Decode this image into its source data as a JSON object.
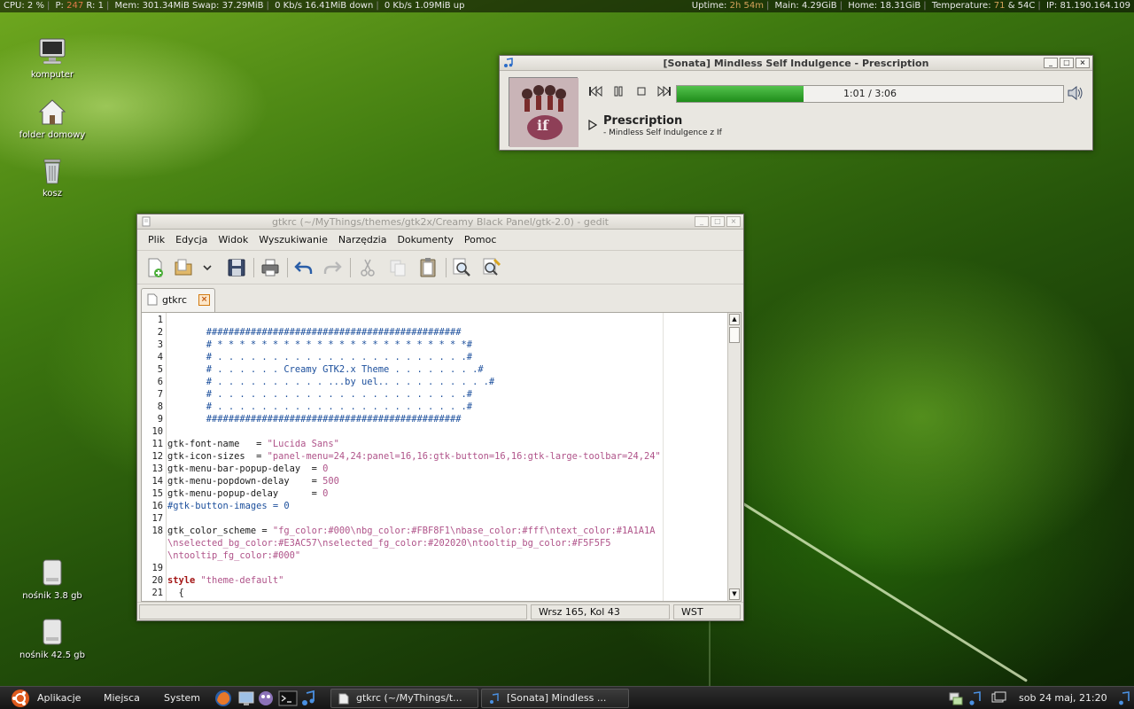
{
  "conky": {
    "cpu_label": "CPU:",
    "cpu_value": "2",
    "cpu_unit": "%",
    "proc_label": "P:",
    "proc_value": "247",
    "run_label": "R:",
    "run_value": "1",
    "mem_text": "Mem: 301.34MiB Swap: 37.29MiB",
    "down_text": "0  Kb/s 16.41MiB down",
    "up_text": "0  Kb/s 1.09MiB up",
    "uptime_label": "Uptime:",
    "uptime_value": "2h 54m",
    "main_text": "Main: 4.29GiB",
    "home_text": "Home: 18.31GiB",
    "temp_label": "Temperature:",
    "temp_value": "71",
    "temp_extra": "& 54C",
    "ip_text": "IP: 81.190.164.109"
  },
  "desktop": {
    "icons": [
      {
        "label": "komputer",
        "icon": "computer-icon"
      },
      {
        "label": "folder domowy",
        "icon": "home-folder-icon"
      },
      {
        "label": "kosz",
        "icon": "trash-icon"
      },
      {
        "label": "nośnik 3.8 gb",
        "icon": "drive-icon"
      },
      {
        "label": "nośnik 42.5 gb",
        "icon": "drive-icon"
      }
    ]
  },
  "sonata": {
    "title": "[Sonata] Mindless Self Indulgence - Prescription",
    "time": "1:01 / 3:06",
    "progress": 0.328,
    "song": "Prescription",
    "artist_line": "- Mindless Self Indulgence z If",
    "art_text": "if",
    "win_buttons": [
      "_",
      "□",
      "×"
    ]
  },
  "gedit": {
    "title": "gtkrc (~/MyThings/themes/gtk2x/Creamy Black Panel/gtk-2.0) - gedit",
    "menu": [
      "Plik",
      "Edycja",
      "Widok",
      "Wyszukiwanie",
      "Narzędzia",
      "Dokumenty",
      "Pomoc"
    ],
    "tab_label": "gtkrc",
    "tab_close": "×",
    "status_position": "Wrsz 165, Kol 43",
    "status_mode": "WST",
    "lines": [
      {
        "n": "1",
        "parts": [
          {
            "t": "",
            "c": ""
          }
        ]
      },
      {
        "n": "2",
        "parts": [
          {
            "t": "       ##############################################",
            "c": "cmt"
          }
        ]
      },
      {
        "n": "3",
        "parts": [
          {
            "t": "       # * * * * * * * * * * * * * * * * * * * * * * *#",
            "c": "cmt"
          }
        ]
      },
      {
        "n": "4",
        "parts": [
          {
            "t": "       # . . . . . . . . . . . . . . . . . . . . . . .#",
            "c": "cmt"
          }
        ]
      },
      {
        "n": "5",
        "parts": [
          {
            "t": "       # . . . . . . Creamy GTK2.x Theme . . . . . . . .#",
            "c": "cmt"
          }
        ]
      },
      {
        "n": "6",
        "parts": [
          {
            "t": "       # . . . . . . . . . . ...by uel.. . . . . . . . . .#",
            "c": "cmt"
          }
        ]
      },
      {
        "n": "7",
        "parts": [
          {
            "t": "       # . . . . . . . . . . . . . . . . . . . . . . .#",
            "c": "cmt"
          }
        ]
      },
      {
        "n": "8",
        "parts": [
          {
            "t": "       # . . . . . . . . . . . . . . . . . . . . . . .#",
            "c": "cmt"
          }
        ]
      },
      {
        "n": "9",
        "parts": [
          {
            "t": "       ##############################################",
            "c": "cmt"
          }
        ]
      },
      {
        "n": "10",
        "parts": [
          {
            "t": "",
            "c": ""
          }
        ]
      },
      {
        "n": "11",
        "parts": [
          {
            "t": "gtk-font-name   = ",
            "c": ""
          },
          {
            "t": "\"Lucida Sans\"",
            "c": "str"
          }
        ]
      },
      {
        "n": "12",
        "parts": [
          {
            "t": "gtk-icon-sizes  = ",
            "c": ""
          },
          {
            "t": "\"panel-menu=24,24:panel=16,16:gtk-button=16,16:gtk-large-toolbar=24,24\"",
            "c": "str"
          }
        ]
      },
      {
        "n": "13",
        "parts": [
          {
            "t": "gtk-menu-bar-popup-delay  = ",
            "c": ""
          },
          {
            "t": "0",
            "c": "num"
          }
        ]
      },
      {
        "n": "14",
        "parts": [
          {
            "t": "gtk-menu-popdown-delay    = ",
            "c": ""
          },
          {
            "t": "500",
            "c": "num"
          }
        ]
      },
      {
        "n": "15",
        "parts": [
          {
            "t": "gtk-menu-popup-delay      = ",
            "c": ""
          },
          {
            "t": "0",
            "c": "num"
          }
        ]
      },
      {
        "n": "16",
        "parts": [
          {
            "t": "#gtk-button-images = 0",
            "c": "cmt"
          }
        ]
      },
      {
        "n": "17",
        "parts": [
          {
            "t": "",
            "c": ""
          }
        ]
      },
      {
        "n": "18",
        "parts": [
          {
            "t": "gtk_color_scheme = ",
            "c": ""
          },
          {
            "t": "\"fg_color:#000\\nbg_color:#FBF8F1\\nbase_color:#fff\\ntext_color:#1A1A1A",
            "c": "str"
          }
        ]
      },
      {
        "n": "",
        "parts": [
          {
            "t": "\\nselected_bg_color:#E3AC57\\nselected_fg_color:#202020\\ntooltip_bg_color:#F5F5F5",
            "c": "str"
          }
        ]
      },
      {
        "n": "",
        "parts": [
          {
            "t": "\\ntooltip_fg_color:#000\"",
            "c": "str"
          }
        ]
      },
      {
        "n": "19",
        "parts": [
          {
            "t": "",
            "c": ""
          }
        ]
      },
      {
        "n": "20",
        "parts": [
          {
            "t": "style",
            "c": "kw"
          },
          {
            "t": " ",
            "c": ""
          },
          {
            "t": "\"theme-default\"",
            "c": "str"
          }
        ]
      },
      {
        "n": "21",
        "parts": [
          {
            "t": "  {",
            "c": ""
          }
        ]
      }
    ]
  },
  "panel": {
    "apps_label": "Aplikacje",
    "places_label": "Miejsca",
    "system_label": "System",
    "task1": "gtkrc (~/MyThings/t...",
    "task2": "[Sonata] Mindless ...",
    "clock": "sob 24 maj, 21:20"
  }
}
